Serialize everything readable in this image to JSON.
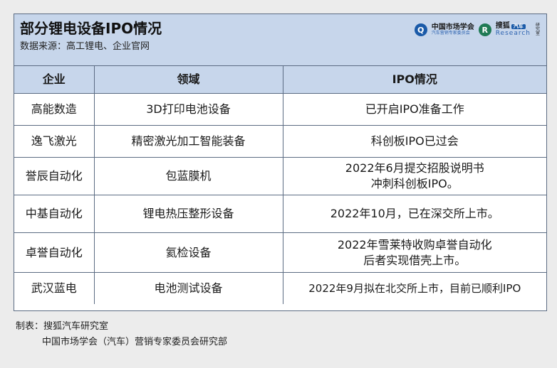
{
  "header": {
    "title": "部分锂电设备IPO情况",
    "source": "数据来源：高工锂电、企业官网",
    "logo": {
      "left_icon": "q-circle-icon",
      "left_name": "中国市场学会",
      "left_sub": "汽车营销专家委员会",
      "right_icon": "research-circle-icon",
      "right_name": "搜狐",
      "right_badge": "汽车",
      "right_research": "Research",
      "right_vert": "研究室"
    }
  },
  "table": {
    "columns": [
      "企业",
      "领域",
      "IPO情况"
    ],
    "rows": [
      {
        "company": "高能数造",
        "field": "3D打印电池设备",
        "ipo": [
          "已开启IPO准备工作"
        ]
      },
      {
        "company": "逸飞激光",
        "field": "精密激光加工智能装备",
        "ipo": [
          "科创板IPO已过会"
        ]
      },
      {
        "company": "誉辰自动化",
        "field": "包蓝膜机",
        "ipo": [
          "2022年6月提交招股说明书",
          "冲刺科创板IPO。"
        ]
      },
      {
        "company": "中基自动化",
        "field": "锂电热压整形设备",
        "ipo": [
          "2022年10月，已在深交所上市。"
        ]
      },
      {
        "company": "卓誉自动化",
        "field": "氦检设备",
        "ipo": [
          "2022年雪莱特收购卓誉自动化",
          "后者实现借壳上市。"
        ]
      },
      {
        "company": "武汉蓝电",
        "field": "电池测试设备",
        "ipo": [
          "2022年9月拟在北交所上市，目前已顺利IPO"
        ]
      }
    ]
  },
  "footer": {
    "line1": "制表：搜狐汽车研究室",
    "line2": "中国市场学会（汽车）营销专家委员会研究部"
  }
}
